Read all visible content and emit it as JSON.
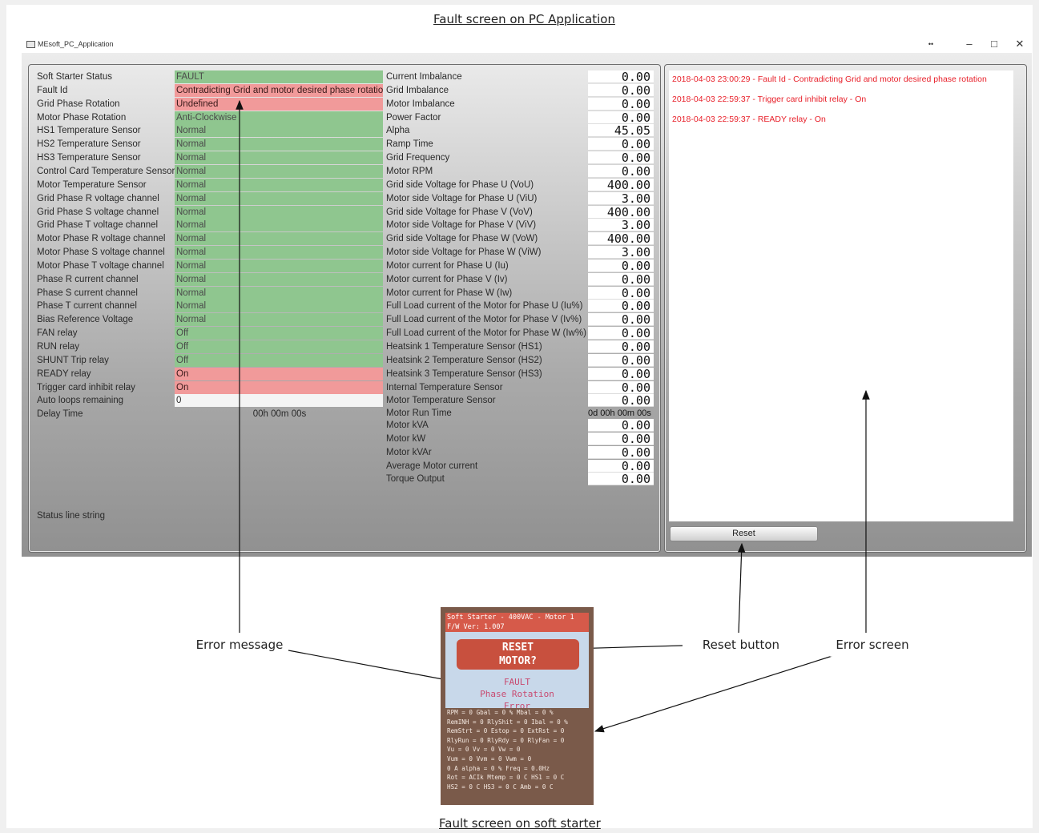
{
  "captions": {
    "top": "Fault screen on PC Application",
    "bottom": "Fault screen on soft starter"
  },
  "window": {
    "title": "MEsoft_PC_Application",
    "btn_extra": "••",
    "btn_min": "–",
    "btn_max": "□",
    "btn_close": "✕"
  },
  "status_rows": [
    {
      "label": "Soft Starter Status",
      "value": "FAULT",
      "color": "green"
    },
    {
      "label": "Fault Id",
      "value": "Contradicting Grid and motor desired phase rotation",
      "color": "red"
    },
    {
      "label": "Grid Phase Rotation",
      "value": "Undefined",
      "color": "red"
    },
    {
      "label": "Motor Phase Rotation",
      "value": "Anti-Clockwise",
      "color": "green"
    },
    {
      "label": "HS1 Temperature Sensor",
      "value": "Normal",
      "color": "green"
    },
    {
      "label": "HS2 Temperature Sensor",
      "value": "Normal",
      "color": "green"
    },
    {
      "label": "HS3 Temperature Sensor",
      "value": "Normal",
      "color": "green"
    },
    {
      "label": "Control Card Temperature Sensor",
      "value": "Normal",
      "color": "green"
    },
    {
      "label": "Motor Temperature Sensor",
      "value": "Normal",
      "color": "green"
    },
    {
      "label": "Grid Phase R voltage channel",
      "value": "Normal",
      "color": "green"
    },
    {
      "label": "Grid Phase S voltage channel",
      "value": "Normal",
      "color": "green"
    },
    {
      "label": "Grid Phase T voltage channel",
      "value": "Normal",
      "color": "green"
    },
    {
      "label": "Motor Phase R voltage channel",
      "value": "Normal",
      "color": "green"
    },
    {
      "label": "Motor Phase S voltage channel",
      "value": "Normal",
      "color": "green"
    },
    {
      "label": "Motor Phase T voltage channel",
      "value": "Normal",
      "color": "green"
    },
    {
      "label": "Phase R current channel",
      "value": "Normal",
      "color": "green"
    },
    {
      "label": "Phase S current channel",
      "value": "Normal",
      "color": "green"
    },
    {
      "label": "Phase T current channel",
      "value": "Normal",
      "color": "green"
    },
    {
      "label": "Bias Reference Voltage",
      "value": "Normal",
      "color": "green"
    },
    {
      "label": "FAN relay",
      "value": "Off",
      "color": "green"
    },
    {
      "label": "RUN relay",
      "value": "Off",
      "color": "green"
    },
    {
      "label": "SHUNT Trip relay",
      "value": "Off",
      "color": "green"
    },
    {
      "label": "READY relay",
      "value": "On",
      "color": "red"
    },
    {
      "label": "Trigger card inhibit relay",
      "value": "On",
      "color": "red"
    },
    {
      "label": "Auto loops remaining",
      "value": "0",
      "color": "white"
    },
    {
      "label": "Delay Time",
      "value": "00h 00m 00s",
      "color": "plain"
    }
  ],
  "status_line": "Status line string",
  "measurements": [
    {
      "label": "Current Imbalance",
      "value": "0.00"
    },
    {
      "label": "Grid Imbalance",
      "value": "0.00"
    },
    {
      "label": "Motor Imbalance",
      "value": "0.00"
    },
    {
      "label": "Power Factor",
      "value": "0.00"
    },
    {
      "label": "Alpha",
      "value": "45.05"
    },
    {
      "label": "Ramp Time",
      "value": "0.00"
    },
    {
      "label": "Grid Frequency",
      "value": "0.00"
    },
    {
      "label": "Motor RPM",
      "value": "0.00"
    },
    {
      "label": "Grid side Voltage for Phase U (VoU)",
      "value": "400.00"
    },
    {
      "label": "Motor side Voltage for Phase U (ViU)",
      "value": "3.00"
    },
    {
      "label": "Grid side Voltage for Phase V (VoV)",
      "value": "400.00"
    },
    {
      "label": "Motor side Voltage for Phase V (ViV)",
      "value": "3.00"
    },
    {
      "label": "Grid side Voltage for Phase W (VoW)",
      "value": "400.00"
    },
    {
      "label": "Motor side Voltage for Phase W (ViW)",
      "value": "3.00"
    },
    {
      "label": "Motor current for Phase U (Iu)",
      "value": "0.00"
    },
    {
      "label": "Motor current for Phase V (Iv)",
      "value": "0.00"
    },
    {
      "label": "Motor current for Phase W (Iw)",
      "value": "0.00"
    },
    {
      "label": "Full Load current of the Motor for Phase U (Iu%)",
      "value": "0.00"
    },
    {
      "label": "Full Load current of the Motor for Phase V (Iv%)",
      "value": "0.00"
    },
    {
      "label": "Full Load current of the Motor for Phase W (Iw%)",
      "value": "0.00"
    },
    {
      "label": "Heatsink 1 Temperature Sensor (HS1)",
      "value": "0.00"
    },
    {
      "label": "Heatsink 2 Temperature Sensor (HS2)",
      "value": "0.00"
    },
    {
      "label": "Heatsink 3 Temperature Sensor (HS3)",
      "value": "0.00"
    },
    {
      "label": "Internal Temperature Sensor",
      "value": "0.00"
    },
    {
      "label": "Motor Temperature Sensor",
      "value": "0.00"
    },
    {
      "label": "Motor Run Time",
      "value": "0d 00h 00m 00s",
      "plain": true
    },
    {
      "label": "Motor kVA",
      "value": "0.00"
    },
    {
      "label": "Motor kW",
      "value": "0.00"
    },
    {
      "label": "Motor kVAr",
      "value": "0.00"
    },
    {
      "label": "Average Motor current",
      "value": "0.00"
    },
    {
      "label": "Torque Output",
      "value": "0.00"
    }
  ],
  "error_log": [
    "2018-04-03 23:00:29  -  Fault Id  -  Contradicting Grid and motor desired phase rotation",
    "2018-04-03 22:59:37  -  Trigger card inhibit relay  -  On",
    "2018-04-03 22:59:37  -  READY relay  -  On"
  ],
  "reset_label": "Reset",
  "callouts": {
    "error_message": "Error message",
    "reset_button": "Reset button",
    "error_screen": "Error screen"
  },
  "device": {
    "header": [
      "Soft Starter - 400VAC - Motor 1",
      "F/W Ver: 1.007"
    ],
    "button": [
      "RESET",
      "MOTOR?"
    ],
    "fault": [
      "FAULT",
      "Phase Rotation",
      "Error"
    ],
    "stats": [
      "RPM = 0   Gbal = 0 %  Mbal = 0 %",
      "RemINH = 0  RlyShit = 0  Ibal = 0 %",
      "RemStrt = 0  Estop = 0  ExtRst = 0",
      "RlyRun = 0  RlyRdy = 0  RlyFan = 0",
      "Vu = 0   Vv = 0   Vw = 0",
      "Vum = 0   Vvm = 0   Vwm = 0",
      "0 A  alpha = 0 %  Freq = 0.0Hz",
      "Rot = ACIk  Mtemp = 0 C  HS1 = 0 C",
      "HS2 = 0 C  HS3 = 0 C  Amb = 0 C"
    ]
  },
  "colors": {
    "ok": "#8fc68f",
    "fault": "#f19a9a",
    "error_text": "#e8202a"
  }
}
